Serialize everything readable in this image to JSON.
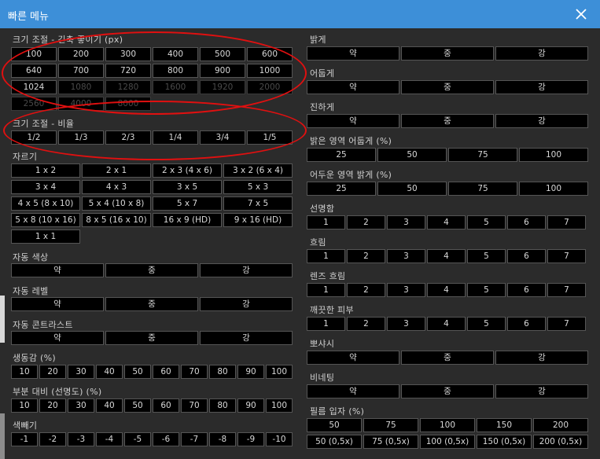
{
  "window": {
    "title": "빠른 메뉴"
  },
  "left": {
    "resize_px": {
      "label": "크기 조절 - 긴축 좋이기 (px)",
      "rows": [
        [
          "100",
          "200",
          "300",
          "400",
          "500",
          "600"
        ],
        [
          "640",
          "700",
          "720",
          "800",
          "900",
          "1000"
        ],
        [
          "1024",
          "1080",
          "1280",
          "1600",
          "1920",
          "2000"
        ],
        [
          "2560",
          "4000",
          "8000"
        ]
      ],
      "disabled_from_row": 2,
      "disabled_from_index": 1
    },
    "resize_ratio": {
      "label": "크기 조절 - 비율",
      "items": [
        "1/2",
        "1/3",
        "2/3",
        "1/4",
        "3/4",
        "1/5"
      ]
    },
    "crop": {
      "label": "자르기",
      "rows": [
        [
          "1 x 2",
          "2 x 1",
          "2 x 3 (4 x 6)",
          "3 x 2 (6 x 4)"
        ],
        [
          "3 x 4",
          "4 x 3",
          "3 x 5",
          "5 x 3"
        ],
        [
          "4 x 5 (8 x 10)",
          "5 x 4 (10 x 8)",
          "5 x 7",
          "7 x 5"
        ],
        [
          "5 x 8 (10 x 16)",
          "8 x 5 (16 x 10)",
          "16 x 9 (HD)",
          "9 x 16 (HD)"
        ],
        [
          "1 x 1"
        ]
      ]
    },
    "auto_color": {
      "label": "자동 색상",
      "items": [
        "약",
        "중",
        "강"
      ]
    },
    "auto_level": {
      "label": "자동 레벨",
      "items": [
        "약",
        "중",
        "강"
      ]
    },
    "auto_contrast": {
      "label": "자동 콘트라스트",
      "items": [
        "약",
        "중",
        "강"
      ]
    },
    "vibrance": {
      "label": "생동감 (%)",
      "items": [
        "10",
        "20",
        "30",
        "40",
        "50",
        "60",
        "70",
        "80",
        "90",
        "100"
      ]
    },
    "local_contrast": {
      "label": "부분 대비 (선명도) (%)",
      "items": [
        "10",
        "20",
        "30",
        "40",
        "50",
        "60",
        "70",
        "80",
        "90",
        "100"
      ]
    },
    "desaturate": {
      "label": "색빼기",
      "items": [
        "-1",
        "-2",
        "-3",
        "-4",
        "-5",
        "-6",
        "-7",
        "-8",
        "-9",
        "-10"
      ]
    }
  },
  "right": {
    "brighter": {
      "label": "밝게",
      "items": [
        "약",
        "중",
        "강"
      ]
    },
    "darker": {
      "label": "어둡게",
      "items": [
        "약",
        "중",
        "강"
      ]
    },
    "deeper": {
      "label": "진하게",
      "items": [
        "약",
        "중",
        "강"
      ]
    },
    "highlight_darken": {
      "label": "밝은 영역 어둡게 (%)",
      "items": [
        "25",
        "50",
        "75",
        "100"
      ]
    },
    "shadow_brighten": {
      "label": "어두운 영역 밝게 (%)",
      "items": [
        "25",
        "50",
        "75",
        "100"
      ]
    },
    "sharpen": {
      "label": "선명함",
      "items": [
        "1",
        "2",
        "3",
        "4",
        "5",
        "6",
        "7"
      ]
    },
    "blur": {
      "label": "흐림",
      "items": [
        "1",
        "2",
        "3",
        "4",
        "5",
        "6",
        "7"
      ]
    },
    "lens_blur": {
      "label": "렌즈 흐림",
      "items": [
        "1",
        "2",
        "3",
        "4",
        "5",
        "6",
        "7"
      ]
    },
    "clean_skin": {
      "label": "깨끗한 피부",
      "items": [
        "1",
        "2",
        "3",
        "4",
        "5",
        "6",
        "7"
      ]
    },
    "soft_focus": {
      "label": "뽀샤시",
      "items": [
        "약",
        "중",
        "강"
      ]
    },
    "vignetting": {
      "label": "비네팅",
      "items": [
        "약",
        "중",
        "강"
      ]
    },
    "film_grain": {
      "label": "필름 입자 (%)",
      "rows": [
        [
          "50",
          "75",
          "100",
          "150",
          "200"
        ],
        [
          "50 (0,5x)",
          "75 (0,5x)",
          "100 (0,5x)",
          "150 (0,5x)",
          "200 (0,5x)"
        ]
      ]
    }
  },
  "colors": {
    "titlebar": "#3d8fd8",
    "background": "#2b2b2b",
    "button_bg": "#000000",
    "highlight_circle": "#e01010"
  },
  "icons": {
    "close": "close-icon"
  }
}
